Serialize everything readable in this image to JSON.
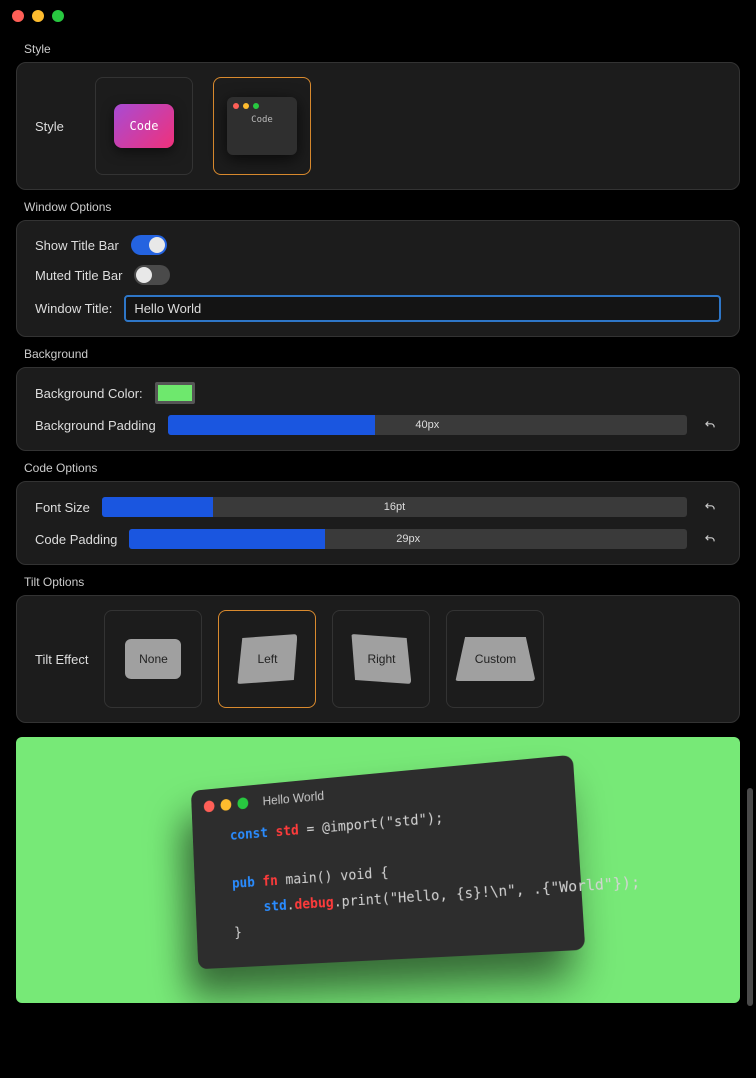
{
  "sections": {
    "style": "Style",
    "window": "Window Options",
    "background": "Background",
    "code": "Code Options",
    "tilt": "Tilt Options"
  },
  "style": {
    "row_label": "Style",
    "card1_label": "Code",
    "card2_label": "Code"
  },
  "window": {
    "show_title_bar_label": "Show Title Bar",
    "show_title_bar_on": true,
    "muted_title_bar_label": "Muted Title Bar",
    "muted_title_bar_on": false,
    "window_title_label": "Window Title:",
    "window_title_value": "Hello World"
  },
  "background": {
    "color_label": "Background Color:",
    "color_value": "#77e977",
    "padding_label": "Background Padding",
    "padding_value": "40px",
    "padding_fill_pct": 40
  },
  "code_opts": {
    "font_size_label": "Font Size",
    "font_size_value": "16pt",
    "font_size_fill_pct": 19,
    "code_padding_label": "Code Padding",
    "code_padding_value": "29px",
    "code_padding_fill_pct": 35
  },
  "tilt": {
    "row_label": "Tilt Effect",
    "options": {
      "none": "None",
      "left": "Left",
      "right": "Right",
      "custom": "Custom"
    },
    "selected": "left"
  },
  "preview": {
    "title": "Hello World",
    "code": {
      "l1_kw": "const",
      "l1_name": "std",
      "l1_rest": " = @import(\"std\");",
      "l3_kw1": "pub",
      "l3_kw2": "fn",
      "l3_rest": " main() void {",
      "l4_obj": "std",
      "l4_dot1": ".",
      "l4_prop": "debug",
      "l4_rest": ".print(\"Hello, {s}!\\n\", .{\"World\"});",
      "l5": "}"
    }
  }
}
